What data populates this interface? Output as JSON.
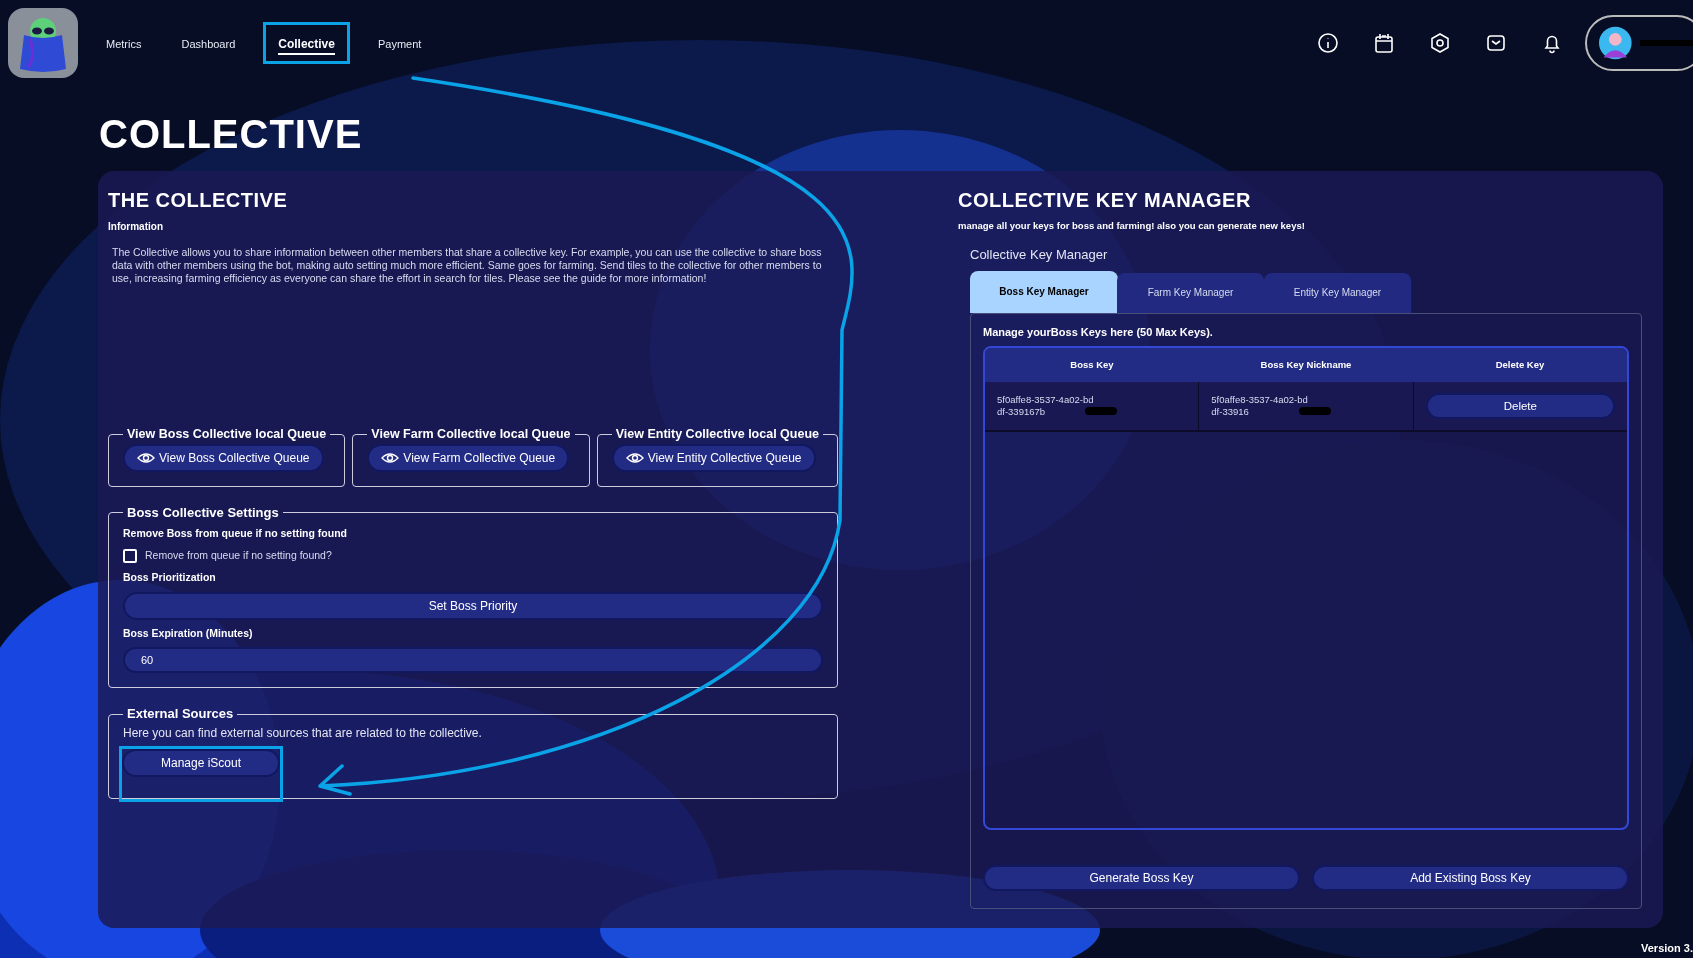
{
  "nav": {
    "items": [
      {
        "label": "Metrics",
        "selected": false,
        "highlighted": false
      },
      {
        "label": "Dashboard",
        "selected": false,
        "highlighted": false
      },
      {
        "label": "Collective",
        "selected": true,
        "highlighted": true
      },
      {
        "label": "Payment",
        "selected": false,
        "highlighted": false
      }
    ]
  },
  "toolbar_icons": [
    {
      "kind": "info"
    },
    {
      "kind": "calendar"
    },
    {
      "kind": "settings"
    },
    {
      "kind": "mail"
    },
    {
      "kind": "bell"
    }
  ],
  "profile": {
    "name_redacted": true
  },
  "page_title": "COLLECTIVE",
  "collective": {
    "title": "THE COLLECTIVE",
    "subtitle": "Information",
    "description": "The Collective allows you to share information between other members that share a collective key. For example, you can use the collective to share boss data with other members using the bot, making auto setting much more efficient. Same goes for farming. Send tiles to the collective for other members to use, increasing farming efficiency as everyone can share the effort in search for tiles. Please see the guide for more information!",
    "queues": [
      {
        "legend": "View Boss Collective  local Queue",
        "button": "View Boss Collective Queue"
      },
      {
        "legend": "View Farm Collective  local Queue",
        "button": "View Farm Collective Queue"
      },
      {
        "legend": "View Entity Collective  local Queue",
        "button": "View Entity Collective Queue"
      }
    ],
    "settings": {
      "legend": "Boss Collective Settings",
      "remove_label": "Remove Boss from queue if no setting found",
      "checkbox": {
        "label": "Remove from queue if no setting found?",
        "checked": false
      },
      "priority_label": "Boss Prioritization",
      "priority_button": "Set Boss Priority",
      "expiration_label": "Boss Expiration (Minutes)",
      "expiration_value": "60"
    },
    "external": {
      "legend": "External Sources",
      "text": "Here you can find external sources that are related to the collective.",
      "button": "Manage iScout",
      "highlighted": true
    }
  },
  "key_manager": {
    "title": "COLLECTIVE KEY MANAGER",
    "subtitle": "manage all your keys for boss and farming! also you can generate new keys!",
    "heading": "Collective Key Manager",
    "tabs": [
      {
        "label": "Boss Key Manager",
        "selected": true
      },
      {
        "label": "Farm Key Manager",
        "selected": false
      },
      {
        "label": "Entity Key Manager",
        "selected": false
      }
    ],
    "note": "Manage yourBoss Keys here (50 Max Keys).",
    "table": {
      "columns": [
        "Boss Key",
        "Boss Key Nickname",
        "Delete Key"
      ],
      "rows": [
        {
          "key": "5f0affe8-3537-4a02-bddf-339167b",
          "nickname": "5f0affe8-3537-4a02-bddf-33916",
          "action": "Delete",
          "redacted": true
        }
      ]
    },
    "buttons": [
      "Generate Boss Key",
      "Add Existing Boss Key"
    ]
  },
  "annotation_arrow": true,
  "version": "Version 3."
}
